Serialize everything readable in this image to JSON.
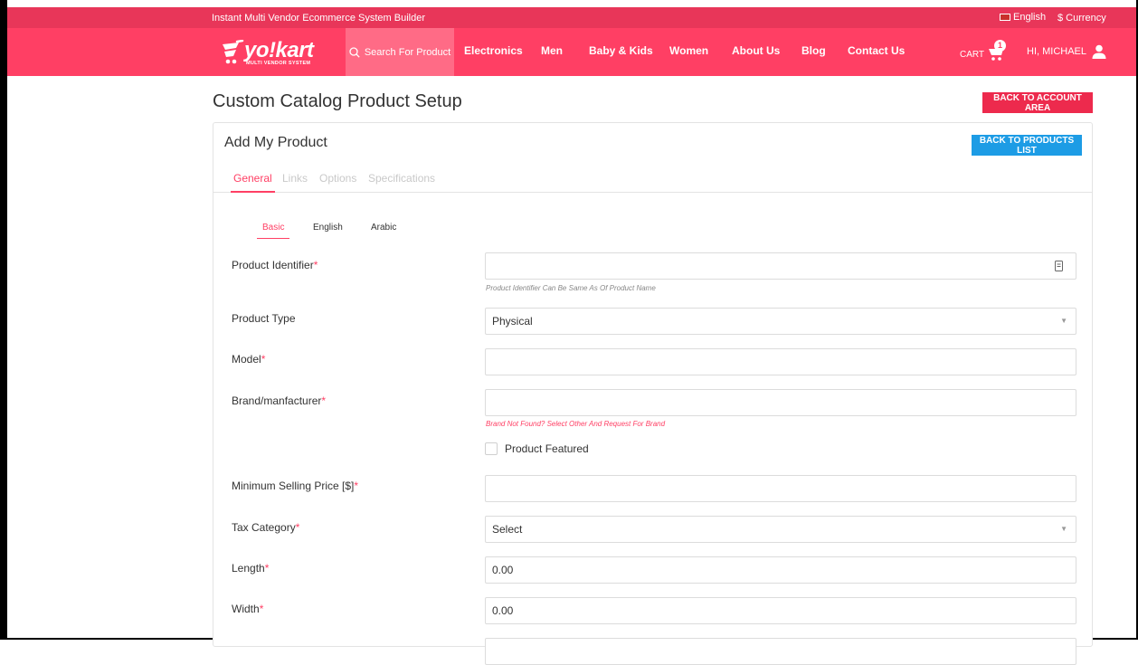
{
  "topbar": {
    "tagline": "Instant Multi Vendor Ecommerce System Builder",
    "language": "English",
    "currency": "$ Currency"
  },
  "header": {
    "logo_text": "yo!kart",
    "logo_sub": "MULTI VENDOR SYSTEM",
    "search_placeholder": "Search For Product",
    "nav_items": [
      {
        "label": "Electronics"
      },
      {
        "label": "Men"
      },
      {
        "label": "Baby & Kids"
      },
      {
        "label": "Women"
      },
      {
        "label": "About Us"
      },
      {
        "label": "Blog"
      },
      {
        "label": "Contact Us"
      }
    ],
    "cart_label": "CART",
    "cart_count": "1",
    "user_greeting": "HI, MICHAEL"
  },
  "page": {
    "title": "Custom Catalog Product Setup",
    "back_account_label": "BACK TO ACCOUNT AREA"
  },
  "card": {
    "title": "Add My Product",
    "back_products_label": "BACK TO PRODUCTS LIST",
    "tabs": [
      {
        "label": "General",
        "active": true
      },
      {
        "label": "Links",
        "active": false
      },
      {
        "label": "Options",
        "active": false
      },
      {
        "label": "Specifications",
        "active": false
      }
    ],
    "subtabs": [
      {
        "label": "Basic",
        "active": true
      },
      {
        "label": "English",
        "active": false
      },
      {
        "label": "Arabic",
        "active": false
      }
    ]
  },
  "form": {
    "product_identifier": {
      "label": "Product Identifier",
      "required": "*",
      "value": "",
      "help": "Product Identifier Can Be Same As Of Product Name"
    },
    "product_type": {
      "label": "Product Type",
      "value": "Physical"
    },
    "model": {
      "label": "Model",
      "required": "*",
      "value": ""
    },
    "brand": {
      "label": "Brand/manfacturer",
      "required": "*",
      "value": "",
      "help": "Brand Not Found? Select Other And Request For Brand"
    },
    "product_featured": {
      "label": "Product Featured",
      "checked": false
    },
    "min_price": {
      "label": "Minimum Selling Price [$]",
      "required": "*",
      "value": ""
    },
    "tax_category": {
      "label": "Tax Category",
      "required": "*",
      "value": "Select"
    },
    "length": {
      "label": "Length",
      "required": "*",
      "value": "0.00"
    },
    "width": {
      "label": "Width",
      "required": "*",
      "value": "0.00"
    }
  },
  "colors": {
    "topbar": "#e83659",
    "navbar": "#ff3f64",
    "accent_red": "#ed2a4d",
    "accent_blue": "#1d9ce5"
  }
}
